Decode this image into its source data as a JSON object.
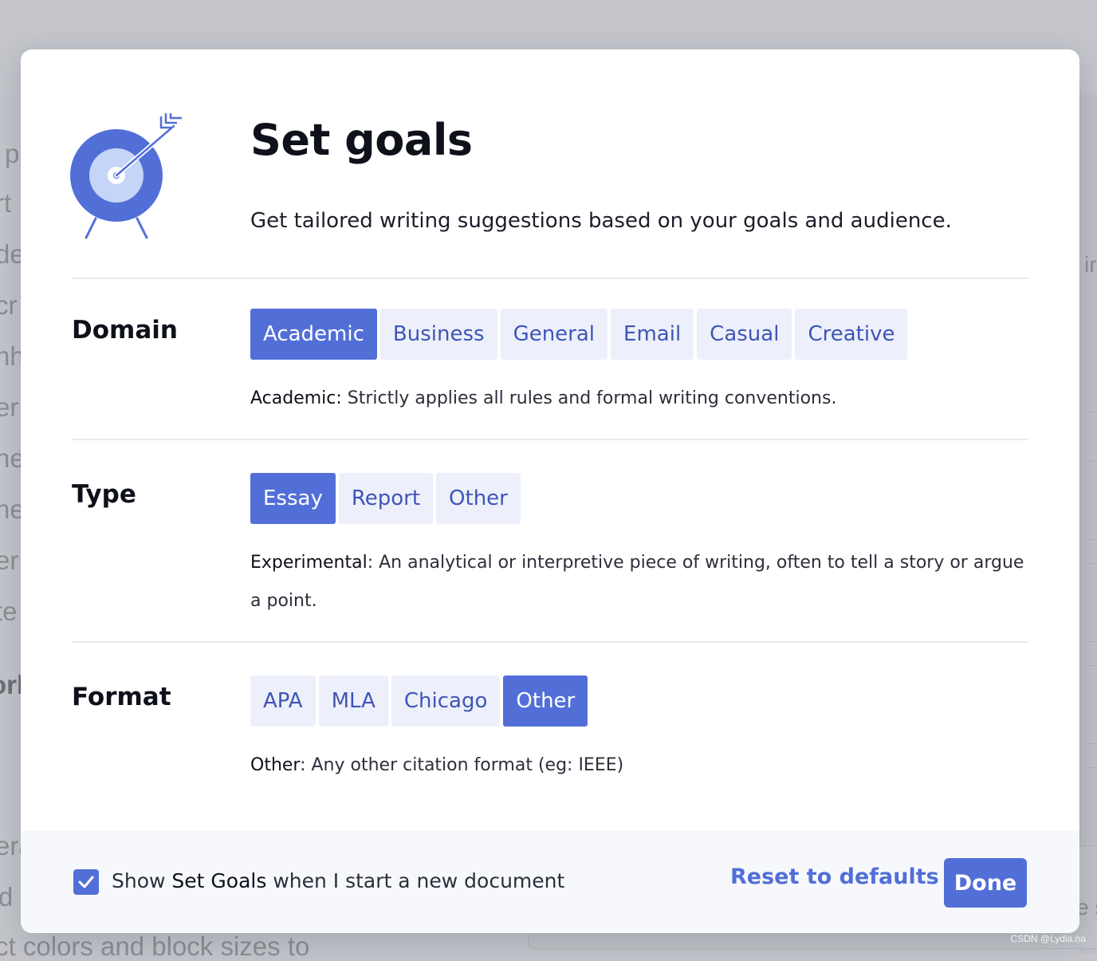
{
  "background": {
    "left_fragments": [
      "p",
      "rt",
      "de",
      "cr",
      "nh",
      "er",
      "ne",
      "he",
      "er",
      "te",
      "orl",
      "era",
      "d c"
    ],
    "right_fragments": [
      "ir",
      "e s"
    ],
    "bottom_text": "ct colors and block sizes to",
    "watermark": "CSDN @Lydia.na"
  },
  "modal": {
    "icon": "target-arrow-icon",
    "title": "Set goals",
    "subtitle": "Get tailored writing suggestions based on your goals and audience."
  },
  "domain": {
    "label": "Domain",
    "options": [
      "Academic",
      "Business",
      "General",
      "Email",
      "Casual",
      "Creative"
    ],
    "selected": "Academic",
    "desc_key": "Academic:",
    "desc_text": " Strictly applies all rules and formal writing conventions."
  },
  "type": {
    "label": "Type",
    "options": [
      "Essay",
      "Report",
      "Other"
    ],
    "selected": "Essay",
    "desc_key": "Experimental",
    "desc_text": ": An analytical or interpretive piece of writing, often to tell a story or argue a point."
  },
  "format": {
    "label": "Format",
    "options": [
      "APA",
      "MLA",
      "Chicago",
      "Other"
    ],
    "selected": "Other",
    "desc_key": "Other",
    "desc_text": ": Any other citation format (eg: IEEE)"
  },
  "footer": {
    "show_checked": true,
    "check_prefix": "Show ",
    "check_strong": "Set Goals",
    "check_suffix": " when I start a new document",
    "reset_label": "Reset to defaults",
    "done_label": "Done"
  },
  "colors": {
    "accent": "#526fd8",
    "option_bg": "#edf0fa",
    "option_text": "#3f55b8",
    "overlay": "#c4c6cc"
  }
}
